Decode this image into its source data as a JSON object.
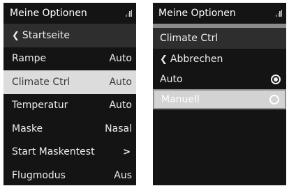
{
  "left_screen": {
    "title": "Meine Optionen",
    "signal_icon": "signal-strength-icon",
    "back": {
      "label": "Startseite",
      "icon": "chevron-left-icon"
    },
    "items": [
      {
        "label": "Rampe",
        "value": "Auto"
      },
      {
        "label": "Climate Ctrl",
        "value": "Auto",
        "selected": true
      },
      {
        "label": "Temperatur",
        "value": "Auto"
      },
      {
        "label": "Maske",
        "value": "Nasal"
      },
      {
        "label": "Start Maskentest",
        "value": ">"
      },
      {
        "label": "Flugmodus",
        "value": "Aus"
      }
    ]
  },
  "right_screen": {
    "title": "Meine Optionen",
    "signal_icon": "signal-strength-icon",
    "section_header": "Climate Ctrl",
    "back": {
      "label": "Abbrechen",
      "icon": "chevron-left-icon"
    },
    "options": [
      {
        "label": "Auto",
        "checked": true
      },
      {
        "label": "Manuell",
        "checked": false,
        "selected": true
      }
    ]
  },
  "colors": {
    "screen_bg": "#141414",
    "highlight_bg": "#dcdcdc",
    "separator": "#8a8a8a"
  }
}
